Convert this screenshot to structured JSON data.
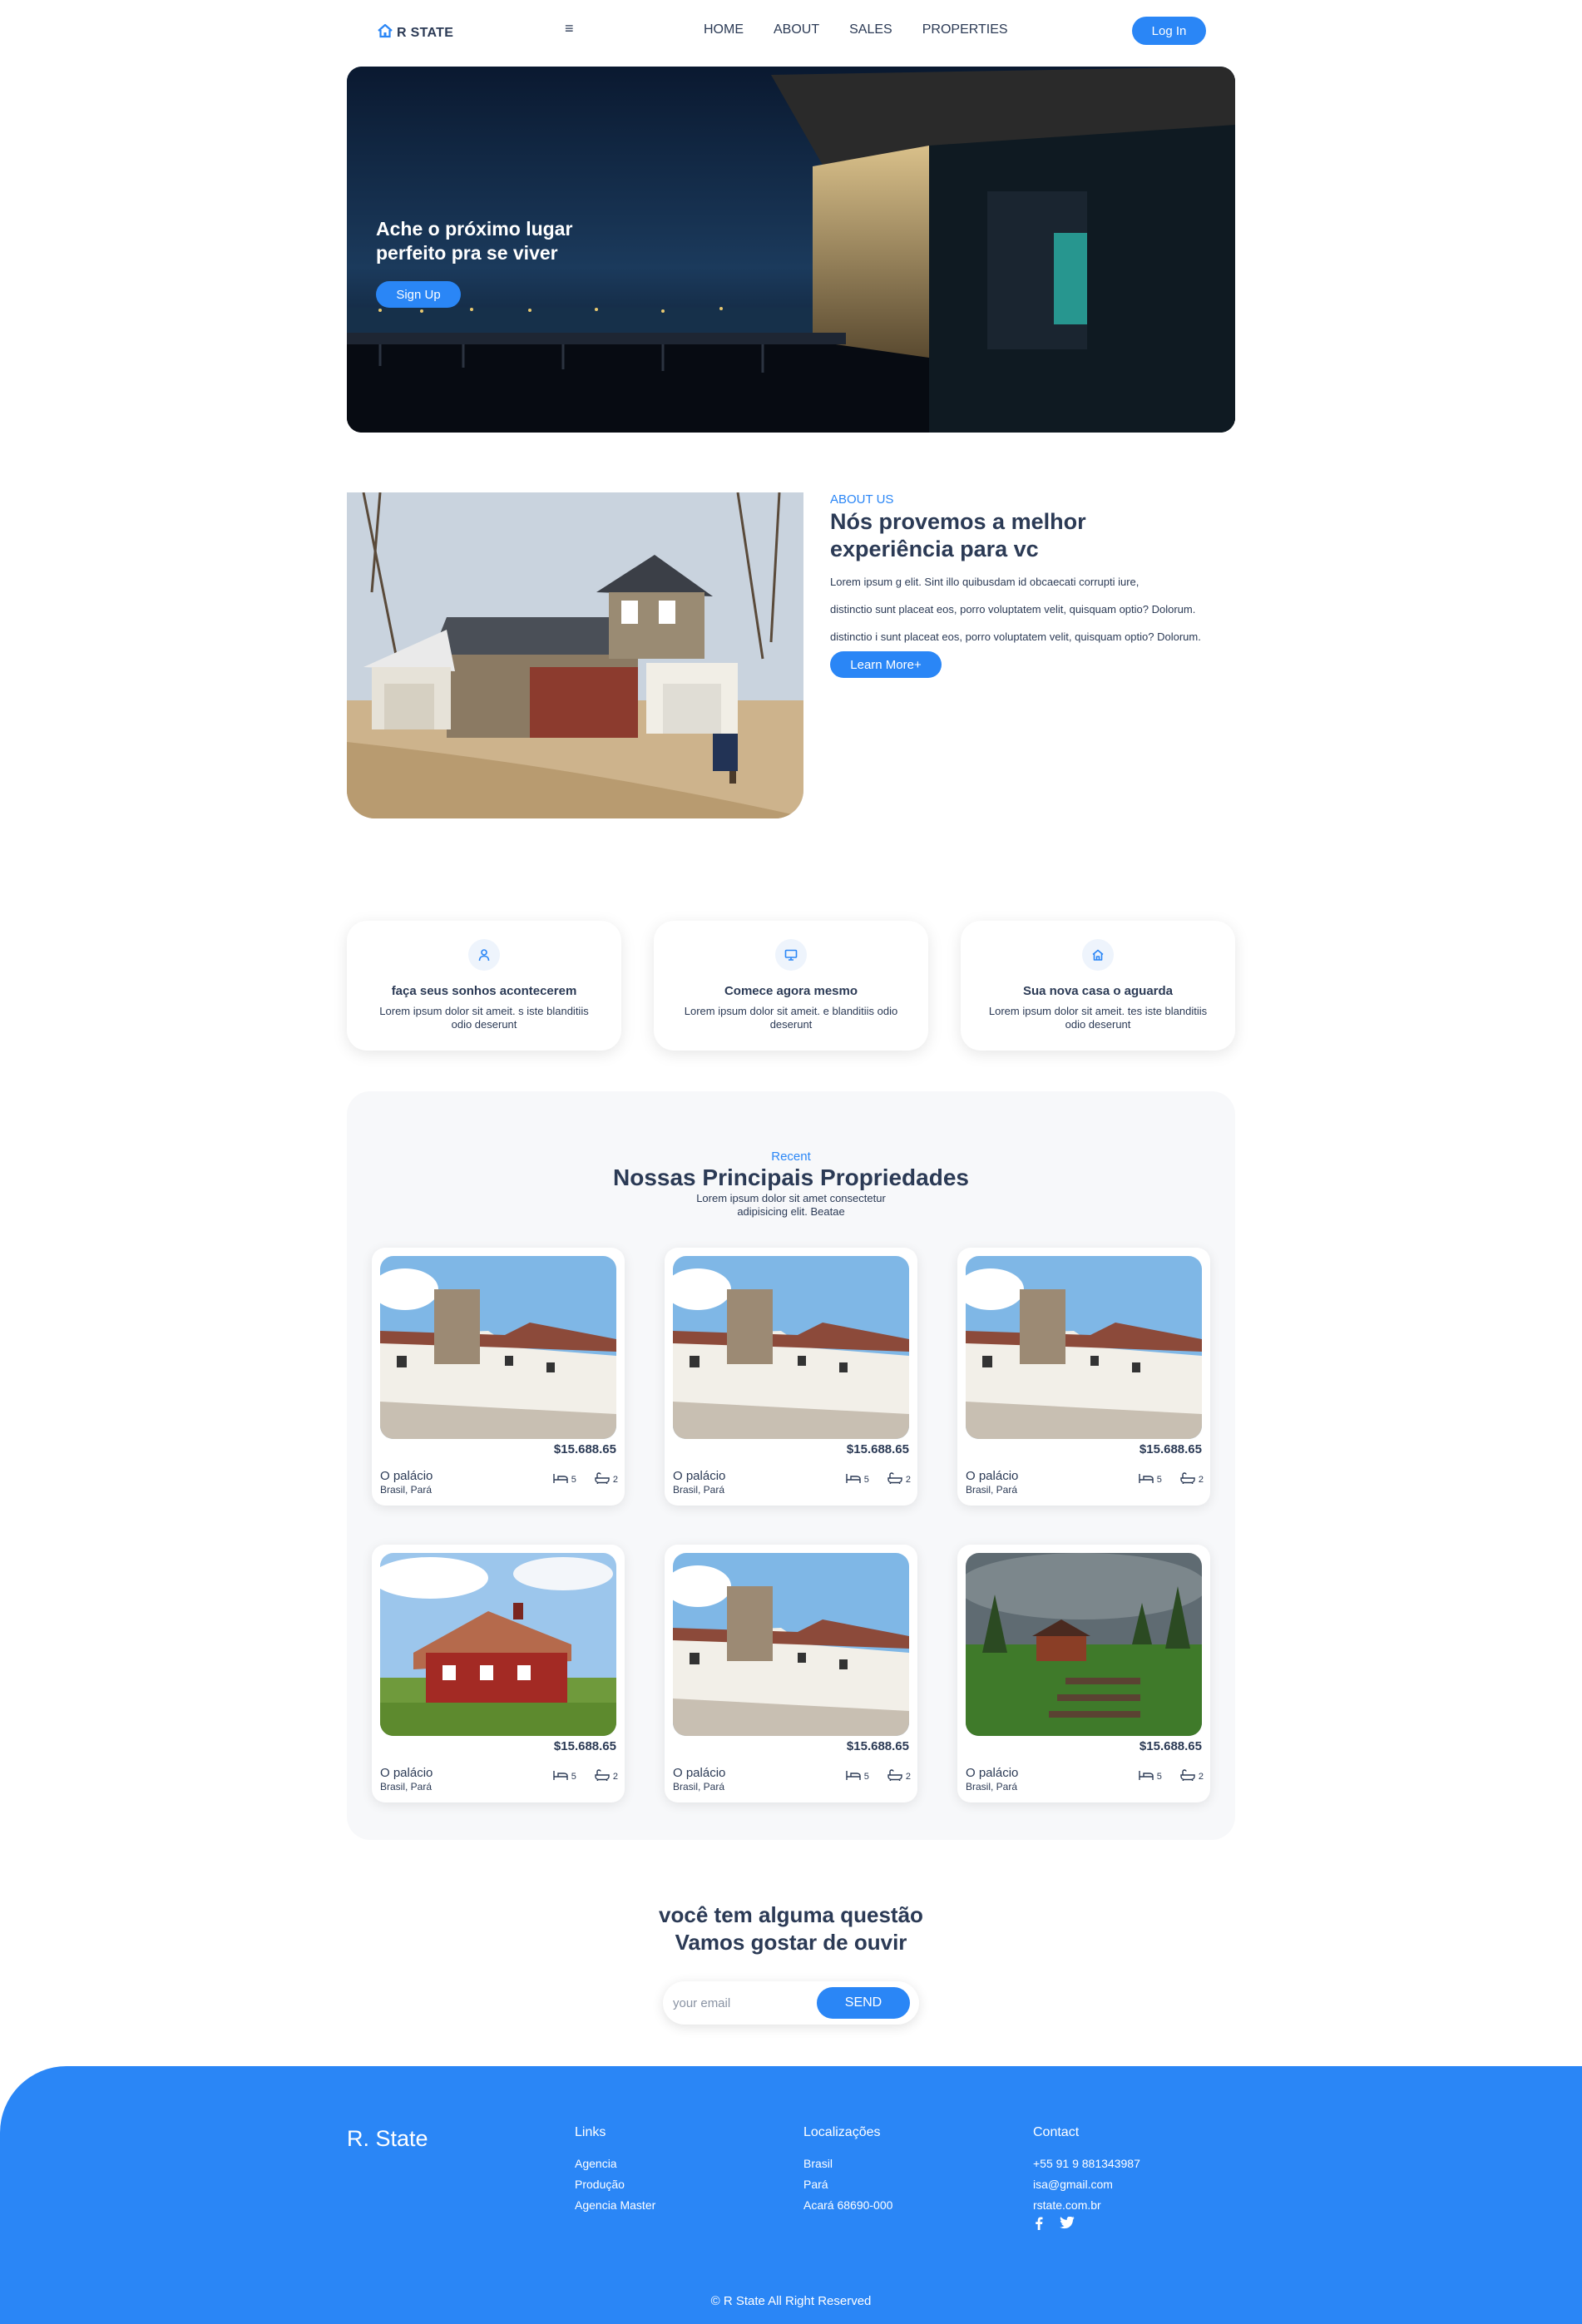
{
  "nav": {
    "logo_text": "R STATE",
    "menu_icon": "hamburger-icon",
    "links": [
      "HOME",
      "ABOUT",
      "SALES",
      "PROPERTIES"
    ],
    "login_label": "Log In"
  },
  "hero": {
    "title": "Ache o próximo lugar perfeito pra se viver",
    "signup_label": "Sign Up"
  },
  "about": {
    "kicker": "ABOUT US",
    "title": "Nós provemos a melhor experiência para vc",
    "paragraphs": [
      "Lorem ipsum g elit. Sint illo quibusdam id obcaecati corrupti iure,",
      "distinctio sunt placeat eos, porro voluptatem velit, quisquam optio? Dolorum.",
      "distinctio i sunt placeat eos, porro voluptatem velit, quisquam optio? Dolorum."
    ],
    "learn_more_label": "Learn More+"
  },
  "features": [
    {
      "icon": "user-icon",
      "title": "faça seus sonhos acontecerem",
      "desc": "Lorem ipsum dolor sit ameit. s iste blanditiis odio deserunt"
    },
    {
      "icon": "monitor-icon",
      "title": "Comece agora mesmo",
      "desc": "Lorem ipsum dolor sit ameit. e blanditiis odio deserunt"
    },
    {
      "icon": "home-icon",
      "title": "Sua nova casa o aguarda",
      "desc": "Lorem ipsum dolor sit ameit. tes iste blanditiis odio deserunt"
    }
  ],
  "properties": {
    "kicker": "Recent",
    "title": "Nossas Principais Propriedades",
    "subtitle_lines": [
      "Lorem ipsum dolor sit amet consectetur",
      "adipisicing elit. Beatae"
    ],
    "cards": [
      {
        "image": "stone-house",
        "price": "$15.688.65",
        "name": "O palácio",
        "location": "Brasil, Pará",
        "beds": "5",
        "baths": "2"
      },
      {
        "image": "stone-house",
        "price": "$15.688.65",
        "name": "O palácio",
        "location": "Brasil, Pará",
        "beds": "5",
        "baths": "2"
      },
      {
        "image": "stone-house",
        "price": "$15.688.65",
        "name": "O palácio",
        "location": "Brasil, Pará",
        "beds": "5",
        "baths": "2"
      },
      {
        "image": "red-barn-house",
        "price": "$15.688.65",
        "name": "O palácio",
        "location": "Brasil, Pará",
        "beds": "5",
        "baths": "2"
      },
      {
        "image": "stone-house",
        "price": "$15.688.65",
        "name": "O palácio",
        "location": "Brasil, Pará",
        "beds": "5",
        "baths": "2"
      },
      {
        "image": "lodge-meadow",
        "price": "$15.688.65",
        "name": "O palácio",
        "location": "Brasil, Pará",
        "beds": "5",
        "baths": "2"
      }
    ]
  },
  "contact": {
    "title_line1": "você tem alguma questão",
    "title_line2": "Vamos gostar de ouvir",
    "email_placeholder": "your email",
    "send_label": "SEND"
  },
  "footer": {
    "brand": "R. State",
    "columns": [
      {
        "title": "Links",
        "items": [
          "Agencia",
          "Produção",
          "Agencia Master"
        ]
      },
      {
        "title": "Localizações",
        "items": [
          "Brasil",
          "Pará",
          "Acará 68690-000"
        ]
      },
      {
        "title": "Contact",
        "items": [
          "+55 91 9 881343987",
          "isa@gmail.com",
          "rstate.com.br"
        ]
      }
    ],
    "socials": [
      "facebook-icon",
      "twitter-icon"
    ],
    "copyright": "© R State All Right Reserved"
  },
  "colors": {
    "accent": "#2a86f6",
    "text": "#2b3a55",
    "panel": "#f7f8fa"
  }
}
